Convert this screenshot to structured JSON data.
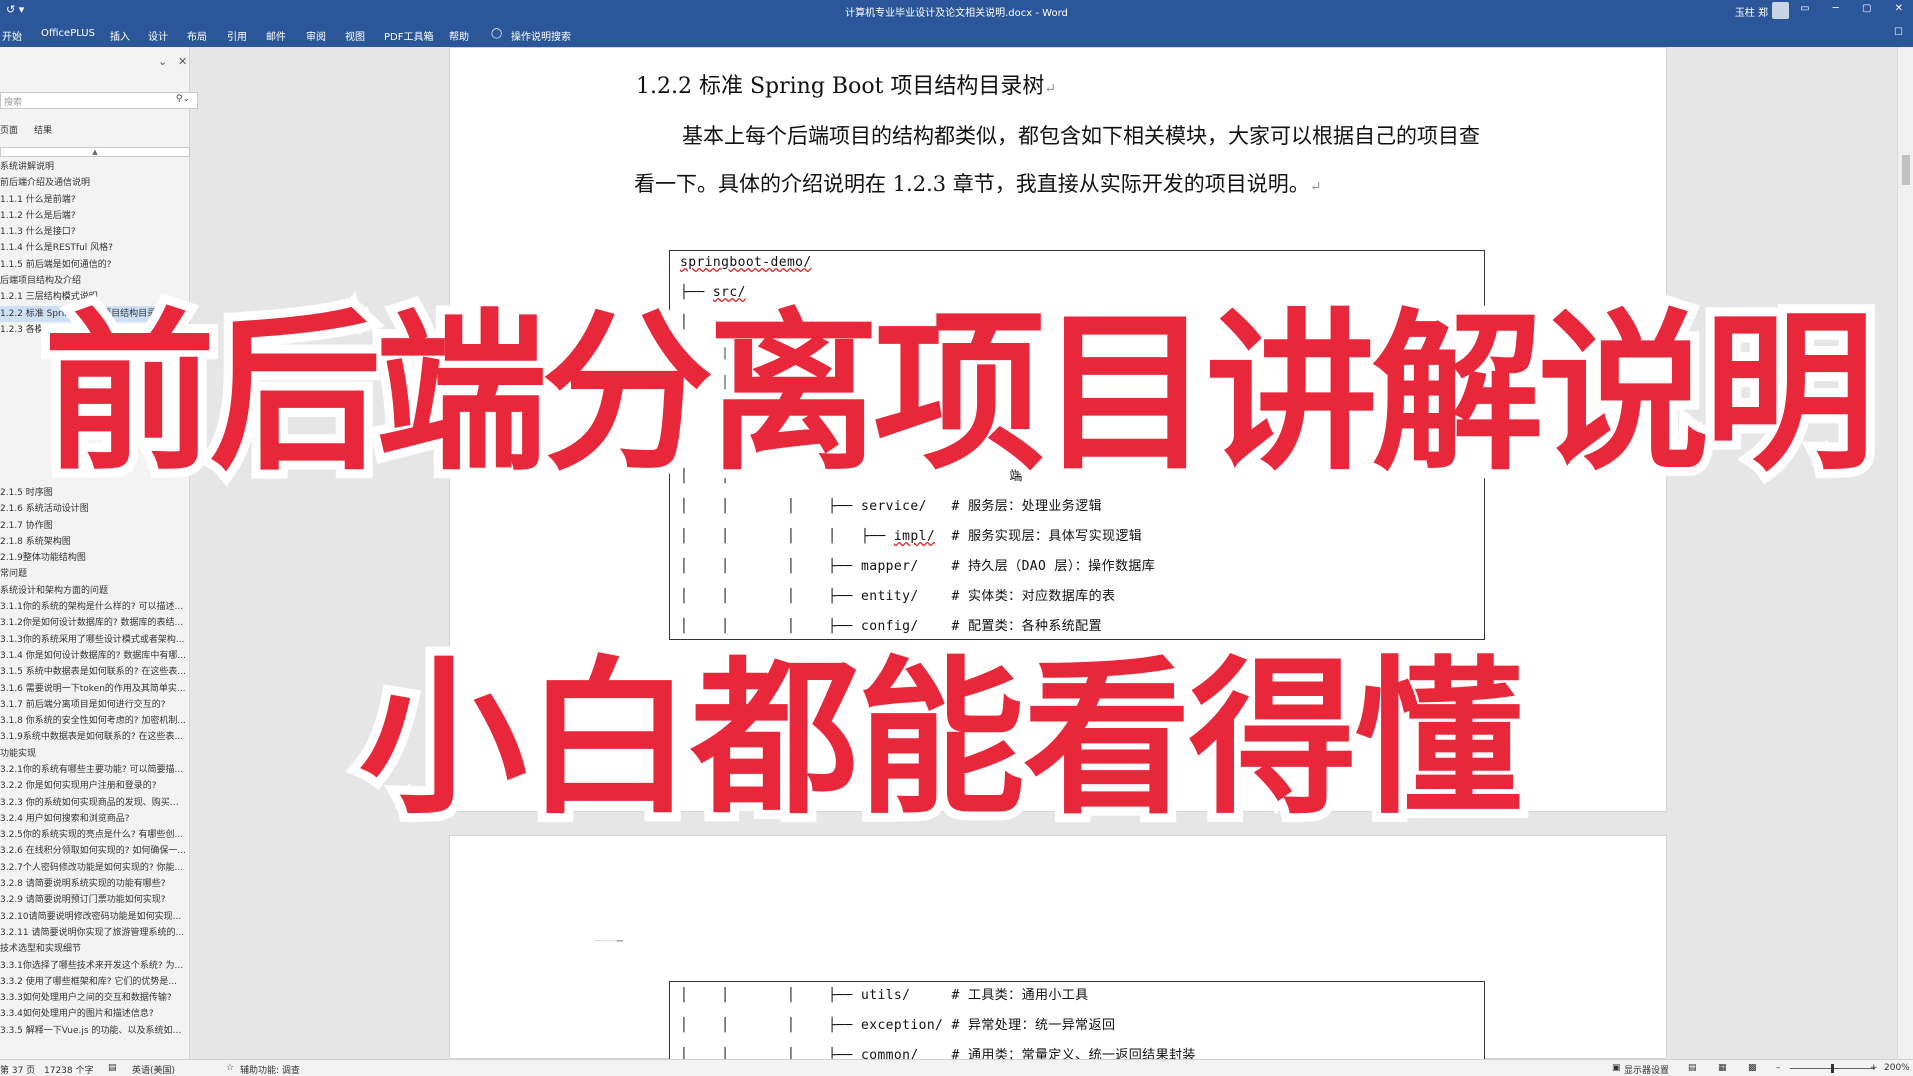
{
  "window": {
    "title": "计算机专业毕业设计及论文相关说明.docx - Word",
    "user": "玉柱 郑",
    "qat": "↺ ▾",
    "controls": "▭ ─ ▢ ✕"
  },
  "ribbon": {
    "tabs": [
      "开始",
      "OfficePLUS",
      "插入",
      "设计",
      "布局",
      "引用",
      "邮件",
      "审阅",
      "视图",
      "PDF工具箱",
      "帮助"
    ],
    "tell_me": "操作说明搜索"
  },
  "nav_pane": {
    "search_placeholder": "搜索",
    "tabs": [
      "页面",
      "结果"
    ],
    "items": [
      "系统讲解说明",
      "前后端介绍及通信说明",
      "1.1.1 什么是前端?",
      "1.1.2 什么是后端?",
      "1.1.3 什么是接口?",
      "1.1.4 什么是RESTful 风格?",
      "1.1.5 前后端是如何通信的?",
      "后端项目结构及介绍",
      "1.2.1 三层结构模式说明",
      "1.2.2 标准 Spring Boot 项目结构目录树",
      "1.2.3 各模块详细说明",
      "",
      "",
      "",
      "",
      "",
      "",
      "",
      "",
      "",
      "2.1.5 时序图",
      "2.1.6 系统活动设计图",
      "2.1.7 协作图",
      "2.1.8 系统架构图",
      "2.1.9整体功能结构图",
      "常问题",
      "系统设计和架构方面的问题",
      "3.1.1你的系统的架构是什么样的? 可以描述...",
      "3.1.2你是如何设计数据库的? 数据库的表结...",
      "3.1.3你的系统采用了哪些设计模式或者架构...",
      "3.1.4 你是如何设计数据库的? 数据库中有哪...",
      "3.1.5 系统中数据表是如何联系的? 在这些表...",
      "3.1.6 需要说明一下token的作用及其简单实...",
      "3.1.7 前后端分离项目是如何进行交互的?",
      "3.1.8 你系统的安全性如何考虑的? 加密机制...",
      "3.1.9系统中数据表是如何联系的? 在这些表...",
      "功能实现",
      "3.2.1你的系统有哪些主要功能? 可以简要描...",
      "3.2.2 你是如何实现用户注册和登录的?",
      "3.2.3 你的系统如何实现商品的发现、购买和...",
      "3.2.4 用户如何搜索和浏览商品?",
      "3.2.5你的系统实现的亮点是什么? 有哪些创...",
      "3.2.6 在线积分领取如何实现的? 如何确保一...",
      "3.2.7个人密码修改功能是如何实现的? 你能...",
      "3.2.8 请简要说明系统实现的功能有哪些?",
      "3.2.9 请简要说明预订门票功能如何实现?",
      "3.2.10请简要说明修改密码功能是如何实现...",
      "3.2.11 请简要说明你实现了旅游管理系统的...",
      "技术选型和实现细节",
      "3.3.1你选择了哪些技术来开发这个系统? 为...",
      "3.3.2 使用了哪些框架和库? 它们的优势是...",
      "3.3.3如何处理用户之间的交互和数据传输?",
      "3.3.4如何处理用户的图片和描述信息?",
      "3.3.5 解释一下Vue.js 的功能、以及系统如何..."
    ]
  },
  "document": {
    "heading": "1.2.2 标准 Spring Boot 项目结构目录树",
    "paragraph": "基本上每个后端项目的结构都类似，都包含如下相关模块，大家可以根据自己的项目查看一下。具体的介绍说明在 1.2.3 章节，我直接从实际开发的项目说明。",
    "code_top": [
      {
        "tree": "",
        "name": "springboot-demo/",
        "comment": ""
      },
      {
        "tree": "├── ",
        "name": "src/",
        "comment": ""
      },
      {
        "tree": "│    ├── ",
        "name": "main/",
        "comment": ""
      },
      {
        "tree": "│    │",
        "name": "",
        "comment": ""
      },
      {
        "tree": "│    │",
        "name": "",
        "comment": ""
      },
      {
        "tree": "│    │",
        "name": "",
        "comment": ""
      },
      {
        "tree": "│    │",
        "name": "",
        "comment": ""
      },
      {
        "tree": "│    │       │    ├── ",
        "name": "service/",
        "comment": "# 服务层：处理业务逻辑"
      },
      {
        "tree": "│    │       │    │   ├── ",
        "name": "impl/",
        "comment": "# 服务实现层：具体写实现逻辑"
      },
      {
        "tree": "│    │       │    ├── ",
        "name": "mapper/",
        "comment": "# 持久层（DAO 层）：操作数据库"
      },
      {
        "tree": "│    │       │    ├── ",
        "name": "entity/",
        "comment": "# 实体类：对应数据库的表"
      },
      {
        "tree": "│    │       │    ├── ",
        "name": "config/",
        "comment": "# 配置类：各种系统配置"
      }
    ],
    "code_bottom": [
      {
        "tree": "│    │       │    ├── ",
        "name": "utils/",
        "comment": "# 工具类：通用小工具"
      },
      {
        "tree": "│    │       │    ├── ",
        "name": "exception/",
        "comment": "# 异常处理：统一异常返回"
      },
      {
        "tree": "│    │       │    ├── ",
        "name": "common/",
        "comment": "# 通用类：常量定义、统一返回结果封装"
      }
    ],
    "partial_comment": "端"
  },
  "overlay": {
    "line1": "前后端分离项目讲解说明",
    "line2": "小白都能看得懂"
  },
  "statusbar": {
    "page": "第 37 页",
    "words": "17238 个字",
    "language": "英语(美国)",
    "accessibility": "辅助功能: 调查",
    "display": "显示器设置",
    "zoom": "200%"
  },
  "colors": {
    "ribbon": "#2b579a",
    "overlay_red": "#e8283a"
  }
}
